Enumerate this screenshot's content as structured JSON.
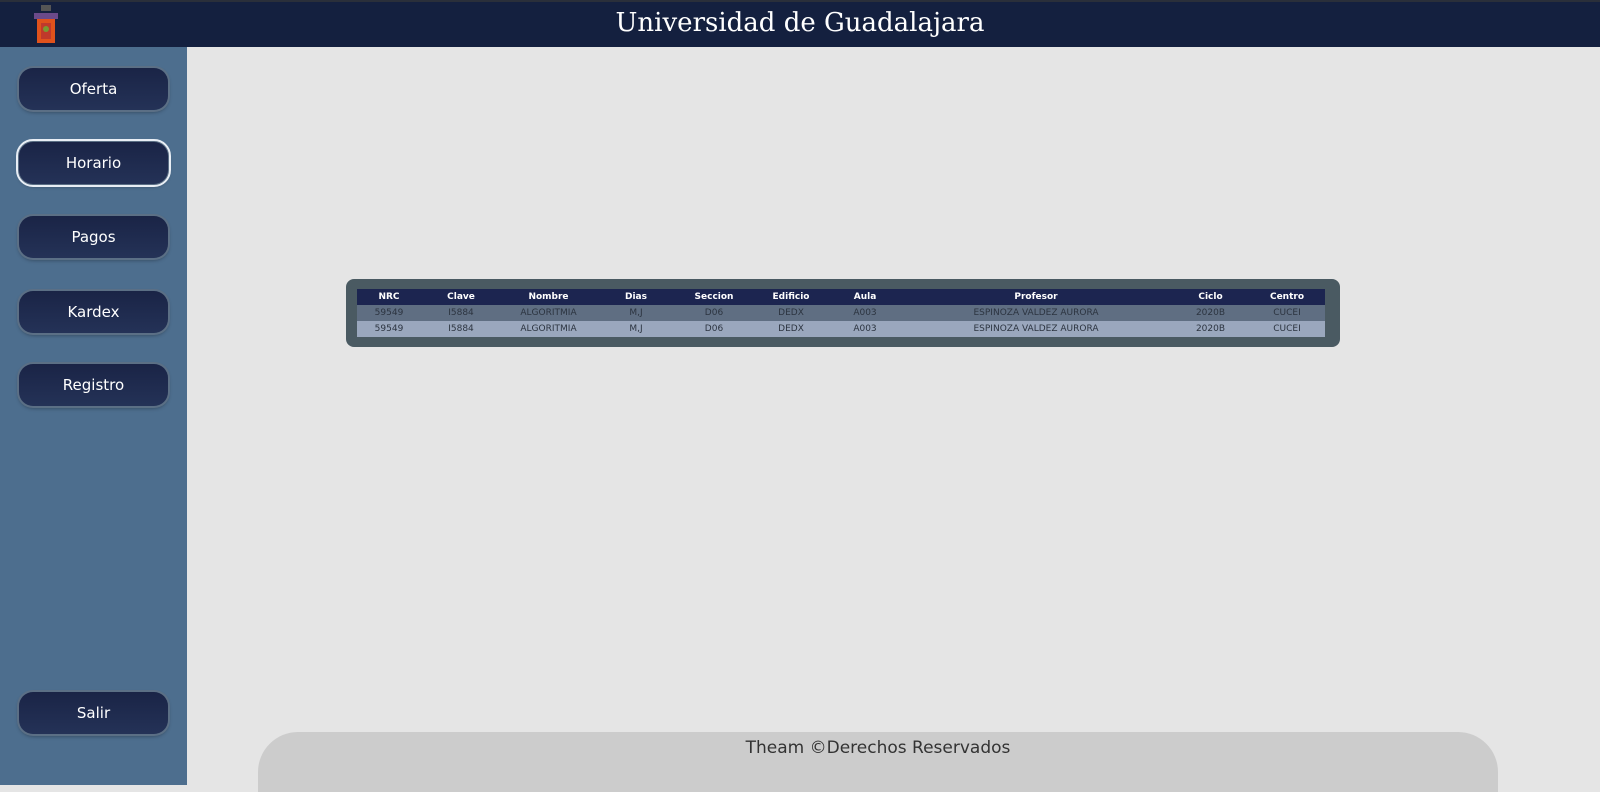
{
  "header": {
    "title": "Universidad de Guadalajara",
    "logo": "university-crest"
  },
  "sidebar": {
    "items": [
      {
        "label": "Oferta"
      },
      {
        "label": "Horario",
        "active": true
      },
      {
        "label": "Pagos"
      },
      {
        "label": "Kardex"
      },
      {
        "label": "Registro"
      }
    ],
    "logout": "Salir"
  },
  "table": {
    "headers": [
      "NRC",
      "Clave",
      "Nombre",
      "Dias",
      "Seccion",
      "Edificio",
      "Aula",
      "Profesor",
      "Ciclo",
      "Centro"
    ],
    "rows": [
      [
        "59549",
        "I5884",
        "ALGORITMIA",
        "M,J",
        "D06",
        "DEDX",
        "A003",
        "ESPINOZA VALDEZ AURORA",
        "2020B",
        "CUCEI"
      ],
      [
        "59549",
        "I5884",
        "ALGORITMIA",
        "M,J",
        "D06",
        "DEDX",
        "A003",
        "ESPINOZA VALDEZ AURORA",
        "2020B",
        "CUCEI"
      ]
    ]
  },
  "footer": {
    "text": "Theam ©Derechos Reservados"
  },
  "colors": {
    "header": "#14203f",
    "sidebar": "#4d6e8e",
    "table_header": "#1c2550"
  }
}
